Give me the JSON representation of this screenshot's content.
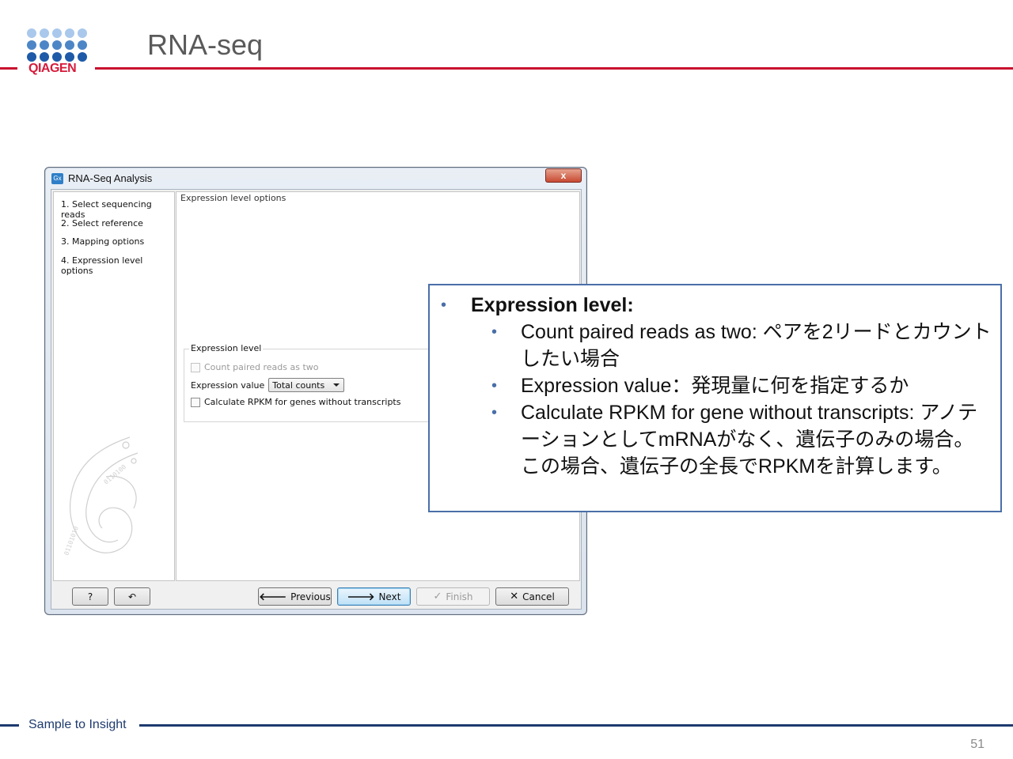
{
  "slide": {
    "title": "RNA-seq",
    "footer": "Sample to Insight",
    "page_number": "51"
  },
  "logo": {
    "text": "QIAGEN",
    "colors": {
      "light": "#8fb7e3",
      "mid": "#4d86c6",
      "dark": "#1e5aa8",
      "text": "#d71a3a"
    }
  },
  "dialog": {
    "title": "RNA-Seq Analysis",
    "app_icon": "Gx",
    "close_icon": "x",
    "steps": [
      "1. Select sequencing reads",
      "2. Select reference",
      "3. Mapping options",
      "4. Expression level options"
    ],
    "panel_title": "Expression level options",
    "group": {
      "label": "Expression level",
      "count_paired_label": "Count paired reads as two",
      "count_paired_checked": false,
      "count_paired_enabled": false,
      "expression_value_label": "Expression value",
      "expression_value_selected": "Total counts",
      "rpkm_label": "Calculate RPKM for genes without transcripts",
      "rpkm_checked": false
    },
    "buttons": {
      "help": "?",
      "reset_icon": "↶",
      "previous": "Previous",
      "next": "Next",
      "finish": "Finish",
      "cancel": "Cancel"
    },
    "icons": {
      "previous": "🡐",
      "next": "🡒",
      "finish": "✓",
      "cancel": "✕"
    }
  },
  "callout": {
    "heading": "Expression level:",
    "bullet": "•",
    "items": [
      "Count paired reads as two: ペアを2リードとカウントしたい場合",
      "Expression value：発現量に何を指定するか",
      "Calculate RPKM for gene without transcripts: アノテーションとしてmRNAがなく、遺伝子のみの場合。この場合、遺伝子の全長でRPKMを計算します。"
    ],
    "border_color": "#4a6fa8"
  }
}
